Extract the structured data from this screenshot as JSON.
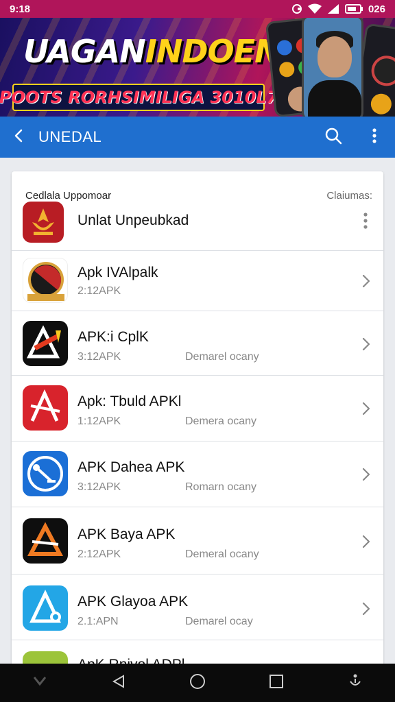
{
  "status_bar": {
    "time": "9:18",
    "battery_text": "026"
  },
  "banner": {
    "title_part1": "UAGAN",
    "title_part2": "INDOENSIA",
    "subtitle": "POOTS RORHSIMILIGA 3010L7"
  },
  "app_bar": {
    "title": "UNEDAL"
  },
  "card": {
    "header_left": "Cedlala Uppomoar",
    "header_right": "Claiumas:",
    "first_item": {
      "name": "Unlat Unpeubkad"
    },
    "items": [
      {
        "name": "Apk IVAlpalk",
        "size": "2:12APK",
        "category": ""
      },
      {
        "name": "APK:i CplK",
        "size": "3:12APK",
        "category": "Demarel ocany"
      },
      {
        "name": "Apk: Tbuld APKl",
        "size": "1:12APK",
        "category": "Demera ocany"
      },
      {
        "name": "APK Dahea APK",
        "size": "3:12APK",
        "category": "Romarn ocany"
      },
      {
        "name": "APK Baya APK",
        "size": "2:12APK",
        "category": "Demeral ocany"
      },
      {
        "name": "APK Glayoa APK",
        "size": "2.1:APN",
        "category": "Demarel ocay"
      },
      {
        "name": "ApK Rnivol ADPl",
        "size": "",
        "category": ""
      }
    ]
  },
  "colors": {
    "status_bar": "#b0155a",
    "app_bar": "#1f6fcf",
    "background": "#e9ebef",
    "nav_bar": "#0b0b0b"
  },
  "icons": [
    "wifi-icon",
    "signal-icon",
    "battery-icon",
    "back-arrow-icon",
    "search-icon",
    "more-vert-icon",
    "chevron-right-icon",
    "nav-back-icon",
    "nav-home-icon",
    "nav-recents-icon",
    "accessibility-icon"
  ]
}
